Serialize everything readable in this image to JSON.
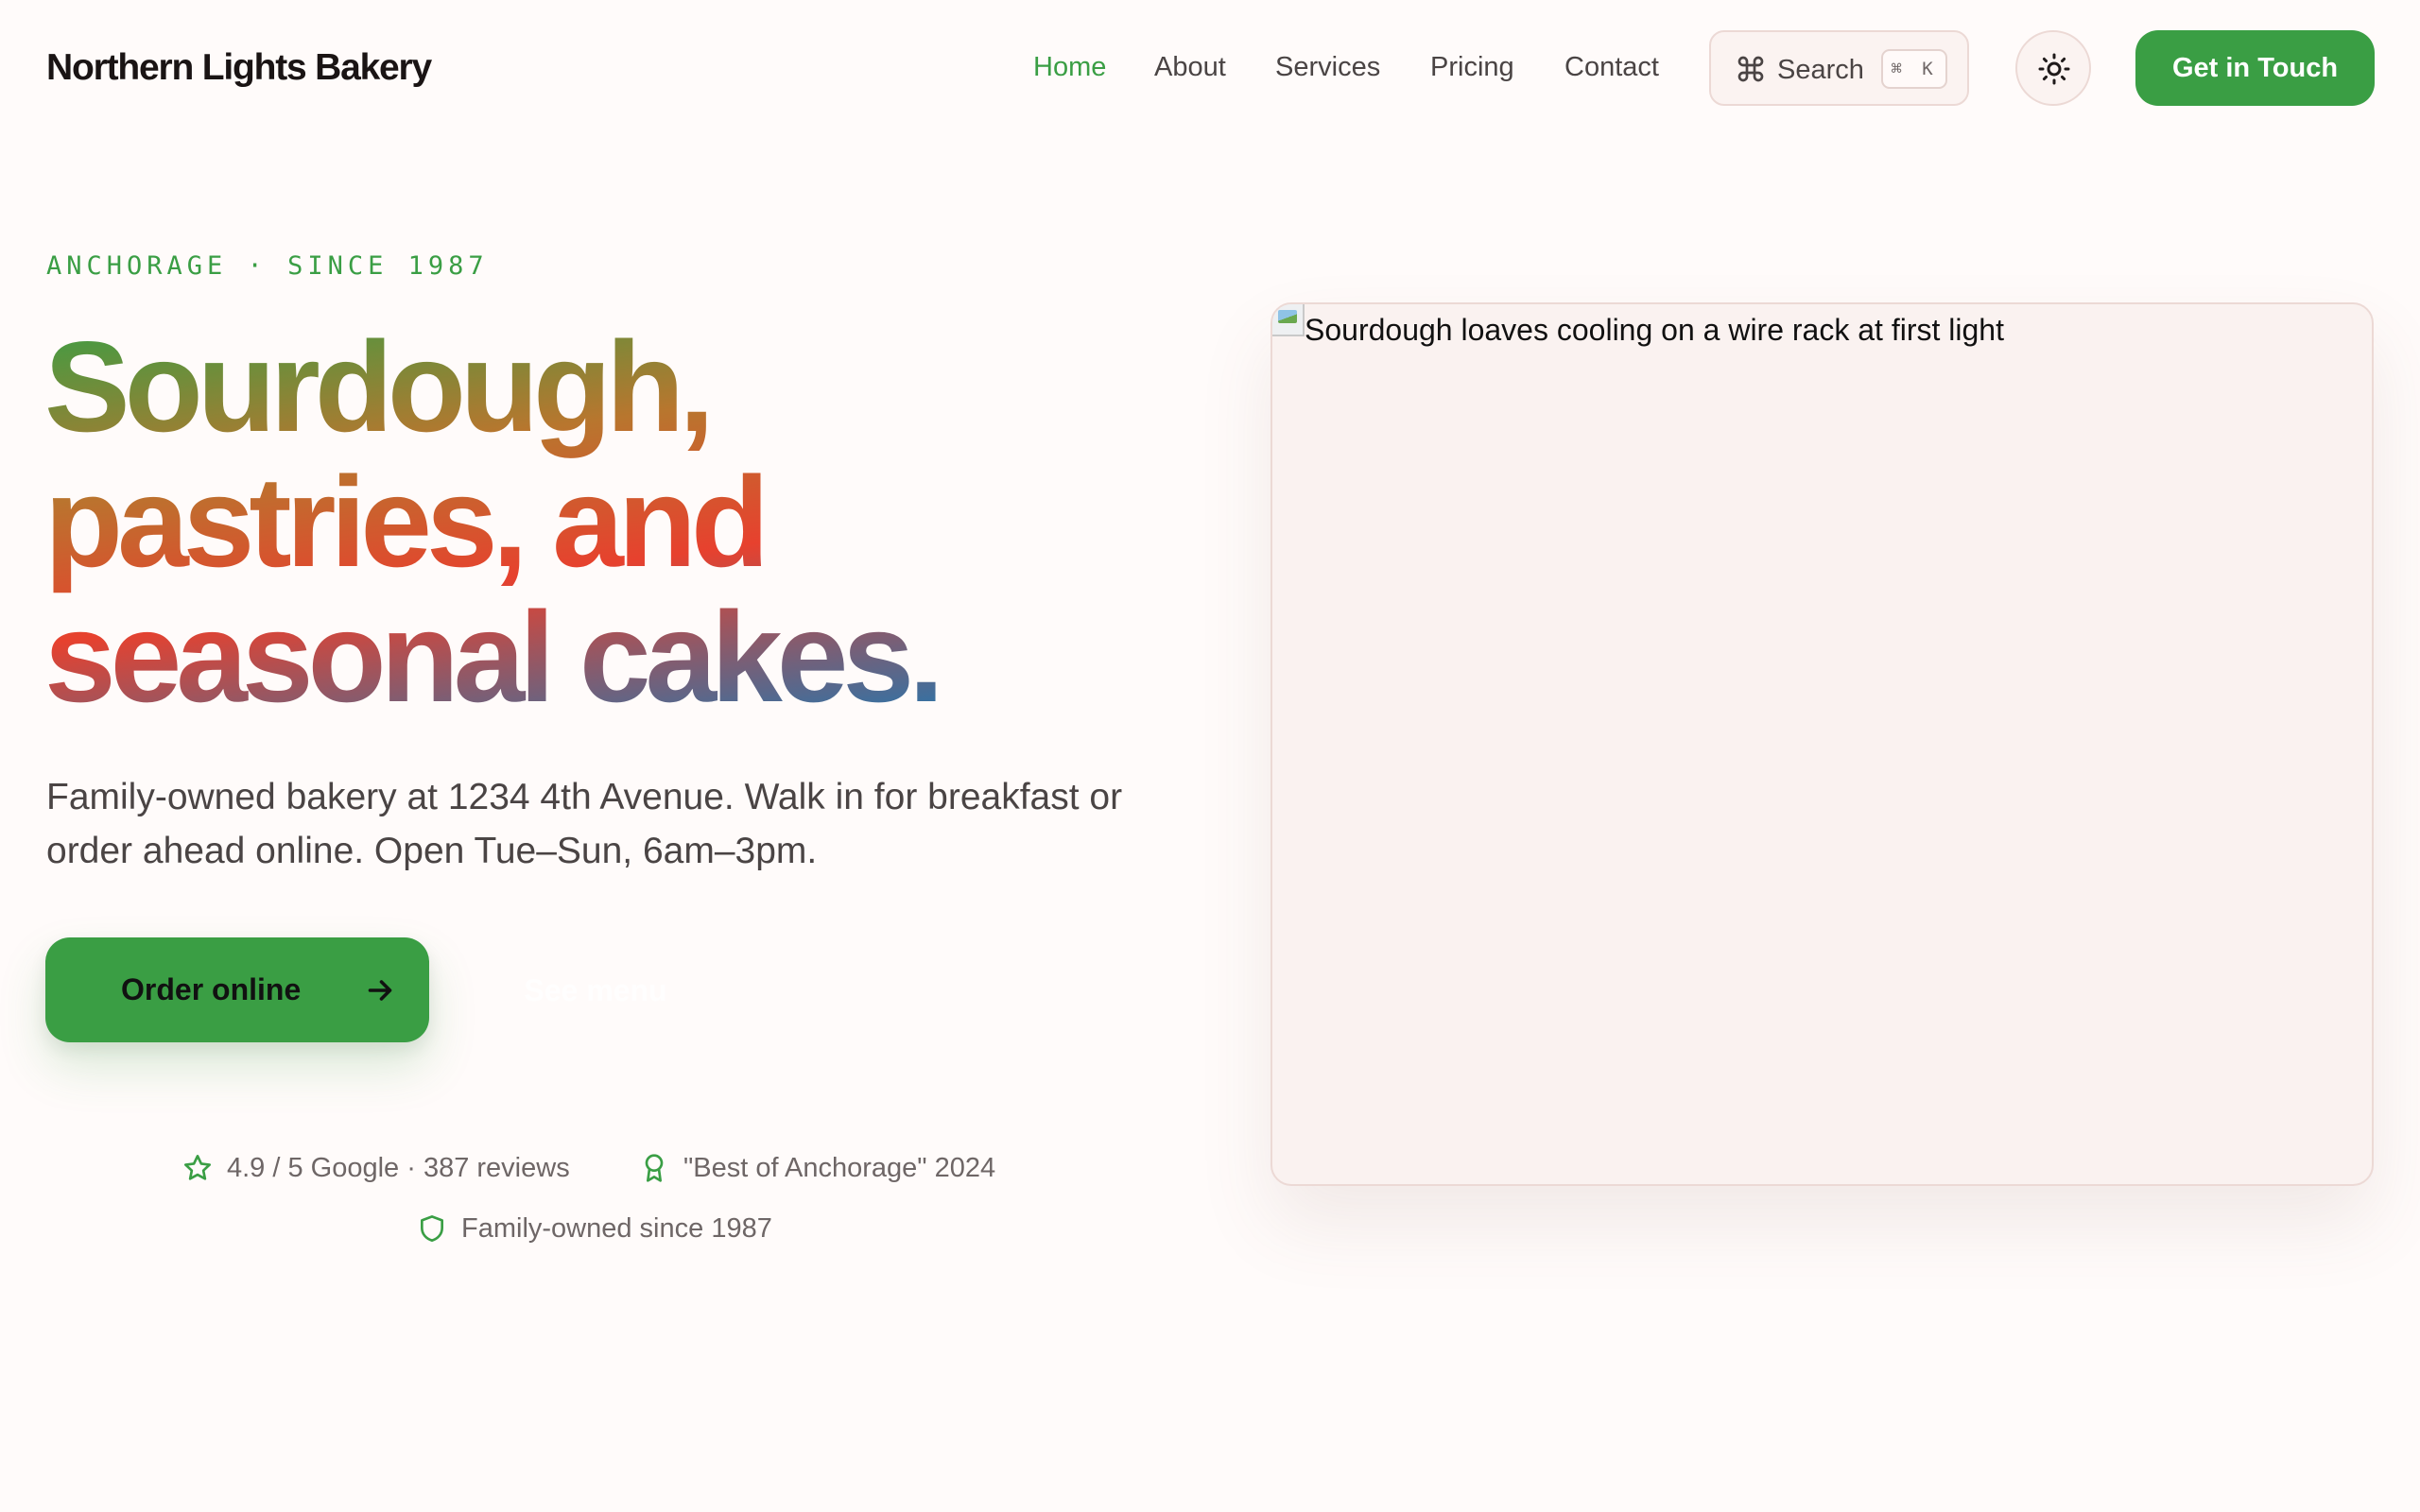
{
  "brand": {
    "name": "Northern Lights Bakery"
  },
  "nav": {
    "items": [
      {
        "label": "Home",
        "active": true
      },
      {
        "label": "About"
      },
      {
        "label": "Services"
      },
      {
        "label": "Pricing"
      },
      {
        "label": "Contact"
      }
    ],
    "search": {
      "label": "Search",
      "shortcut": "⌘ K"
    },
    "cta_label": "Get in Touch"
  },
  "hero": {
    "eyebrow": "ANCHORAGE · SINCE 1987",
    "headline": [
      "Sourdough,",
      "pastries, and",
      "seasonal cakes."
    ],
    "lede": "Family-owned bakery at 1234 4th Avenue. Walk in for breakfast or order ahead online. Open Tue–Sun, 6am–3pm.",
    "primary_cta": "Order online",
    "secondary_cta": "See menu",
    "trust": [
      {
        "icon": "star-icon",
        "text": "4.9 / 5 Google · 387 reviews"
      },
      {
        "icon": "award-icon",
        "text": "\"Best of Anchorage\" 2024"
      },
      {
        "icon": "shield-icon",
        "text": "Family-owned since 1987"
      }
    ]
  },
  "image": {
    "alt": "Sourdough loaves cooling on a wire rack at first light"
  },
  "colors": {
    "accent": "#3a9e44",
    "background": "#fffbfa",
    "card": "#faf2f0",
    "border": "#ecd9d5"
  }
}
